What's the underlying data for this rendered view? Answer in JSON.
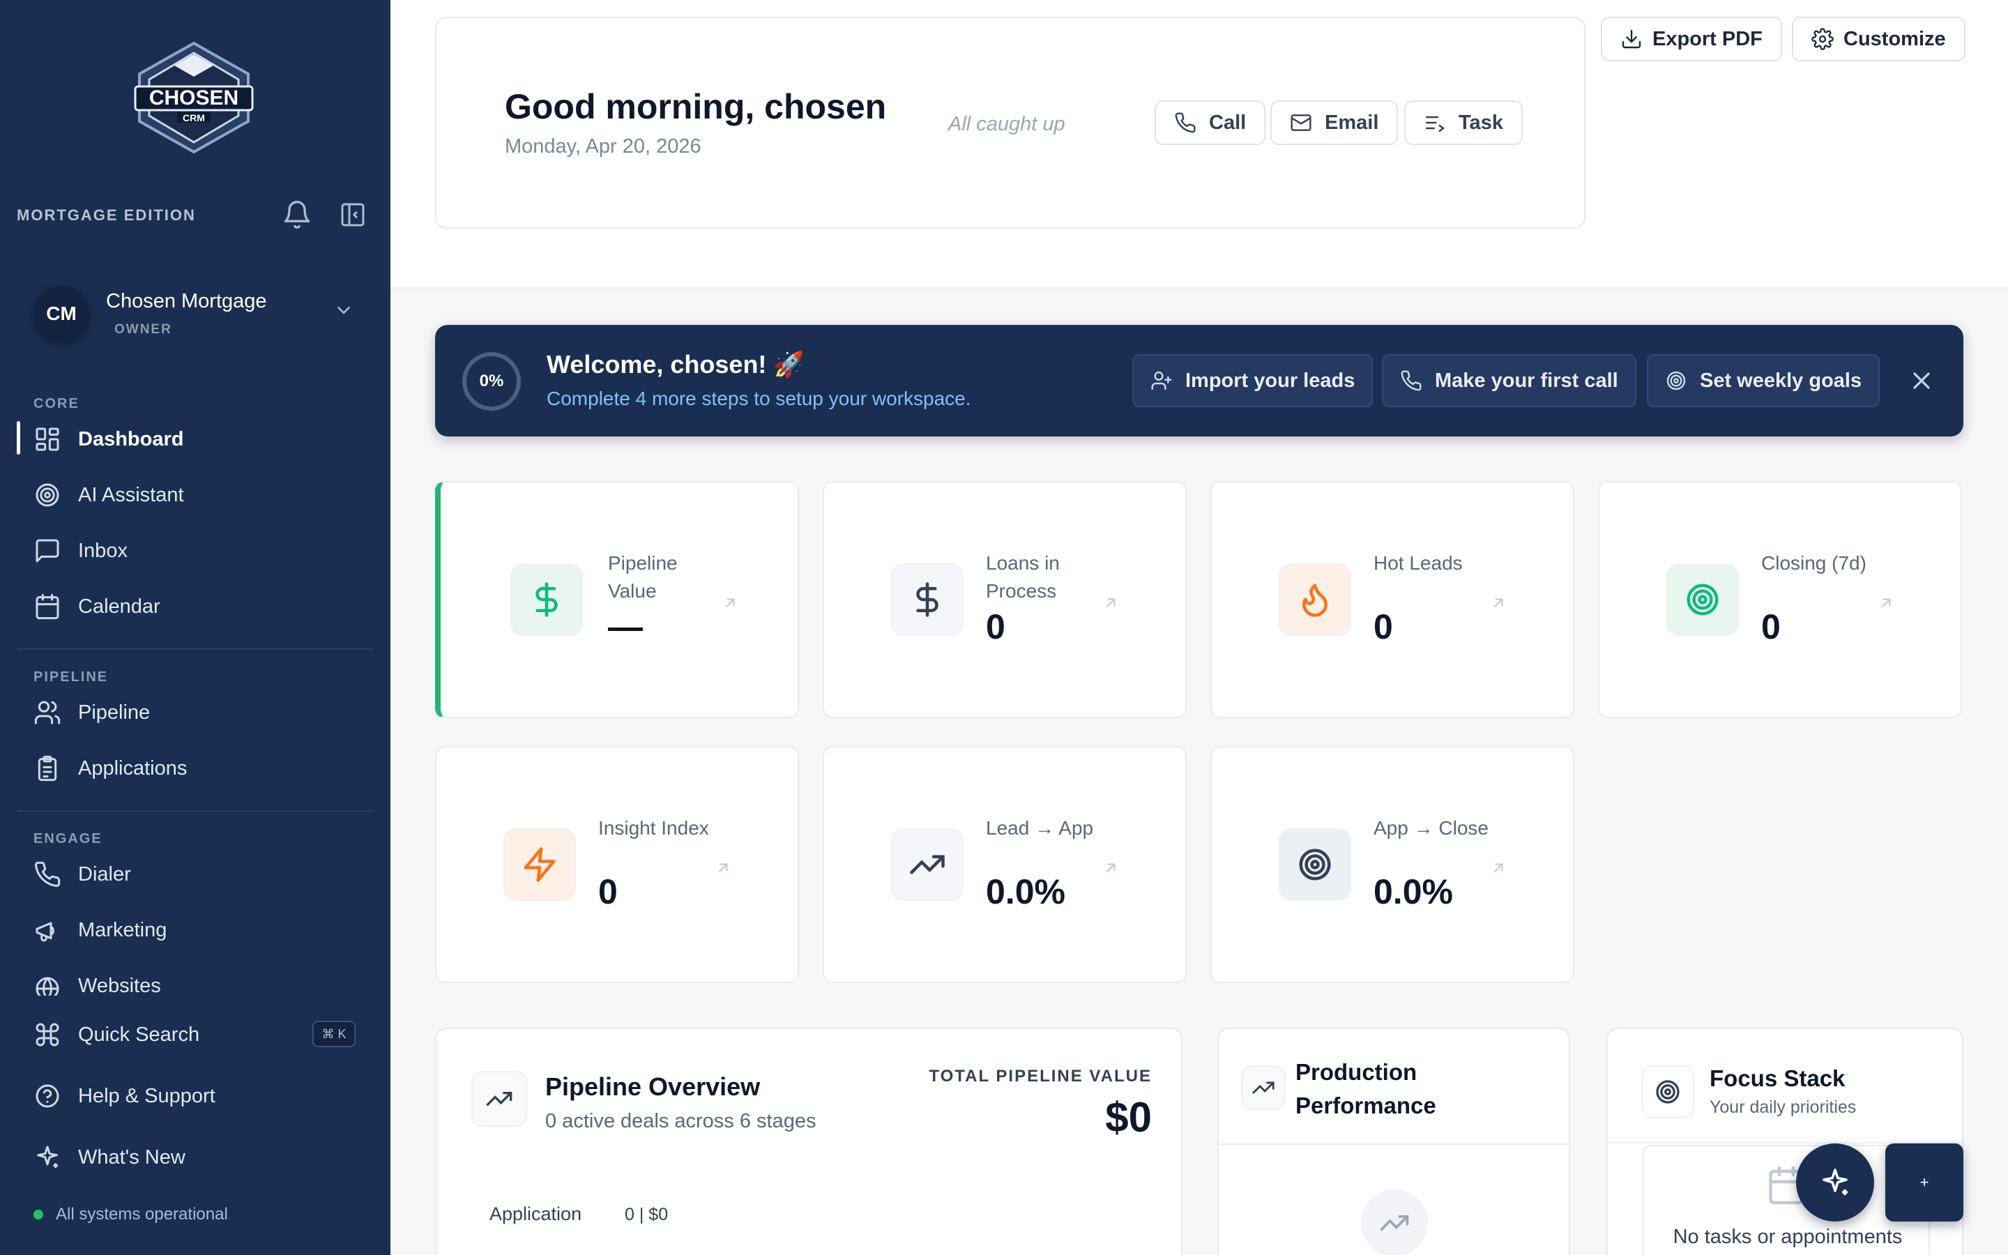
{
  "sidebar": {
    "logo_text": "CHOSEN CRM",
    "edition": "MORTGAGE EDITION",
    "account": {
      "initials": "CM",
      "name": "Chosen Mortgage",
      "role": "OWNER"
    },
    "sections": {
      "core": "CORE",
      "pipeline": "PIPELINE",
      "engage": "ENGAGE"
    },
    "items": [
      {
        "label": "Dashboard",
        "icon": "grid-icon",
        "active": true
      },
      {
        "label": "AI Assistant",
        "icon": "target-icon"
      },
      {
        "label": "Inbox",
        "icon": "message-icon"
      },
      {
        "label": "Calendar",
        "icon": "calendar-icon"
      },
      {
        "label": "Pipeline",
        "icon": "users-icon"
      },
      {
        "label": "Applications",
        "icon": "clipboard-icon"
      },
      {
        "label": "Dialer",
        "icon": "phone-icon"
      },
      {
        "label": "Marketing",
        "icon": "megaphone-icon"
      },
      {
        "label": "Websites",
        "icon": "globe-icon"
      }
    ],
    "footer": {
      "quick_search": "Quick Search",
      "shortcut": "⌘ K",
      "help": "Help & Support",
      "whats_new": "What's New",
      "status": "All systems operational",
      "status_color": "#22c55e"
    }
  },
  "header": {
    "greeting": "Good morning, chosen",
    "date": "Monday, Apr 20, 2026",
    "caught_up": "All caught up",
    "quick_actions": {
      "call": "Call",
      "email": "Email",
      "task": "Task"
    },
    "export": "Export PDF",
    "customize": "Customize"
  },
  "welcome": {
    "progress": "0%",
    "progress_fraction": 0,
    "title": "Welcome, chosen! 🚀",
    "subtitle": "Complete 4 more steps to setup your workspace.",
    "actions": {
      "import": "Import your leads",
      "call": "Make your first call",
      "goals": "Set weekly goals"
    }
  },
  "stats": [
    {
      "label": "Pipeline Value",
      "value": "—",
      "icon": "dollar-icon"
    },
    {
      "label": "Loans in Process",
      "value": "0",
      "icon": "dollar-icon"
    },
    {
      "label": "Hot Leads",
      "value": "0",
      "icon": "flame-icon"
    },
    {
      "label": "Closing (7d)",
      "value": "0",
      "icon": "target-icon"
    },
    {
      "label": "Insight Index",
      "value": "0",
      "icon": "bolt-icon"
    },
    {
      "label": "Lead → App",
      "value": "0.0%",
      "icon": "trend-up-icon"
    },
    {
      "label": "App → Close",
      "value": "0.0%",
      "icon": "target-icon"
    }
  ],
  "colors": {
    "accent_green": "#22b573",
    "navy": "#1a2e52",
    "orange": "#f97316",
    "teal": "#10b981"
  },
  "pipeline_overview": {
    "title": "Pipeline Overview",
    "subtitle": "0 active deals across 6 stages",
    "total_label": "TOTAL PIPELINE VALUE",
    "total_value": "$0",
    "stages": [
      {
        "name": "Application",
        "value": "0 | $0"
      }
    ]
  },
  "production": {
    "title": "Production Performance"
  },
  "focus": {
    "title": "Focus Stack",
    "subtitle": "Your daily priorities",
    "empty": "No tasks or appointments"
  },
  "fab": {
    "secondary": "+"
  }
}
